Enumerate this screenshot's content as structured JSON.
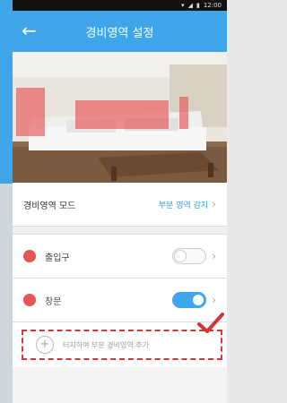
{
  "app": {
    "title": "경비영역 설정"
  },
  "status": {
    "time": "12:00"
  },
  "mode": {
    "label": "경비영역 모드",
    "value": "부분 영역 감지"
  },
  "zones": [
    {
      "label": "출입구",
      "enabled": false
    },
    {
      "label": "창문",
      "enabled": true
    }
  ],
  "add": {
    "label": "터치하여 부분 경비영역 추가"
  },
  "colors": {
    "accent": "#3fa6ea",
    "zone": "#e85555",
    "highlight": "#d33333"
  }
}
